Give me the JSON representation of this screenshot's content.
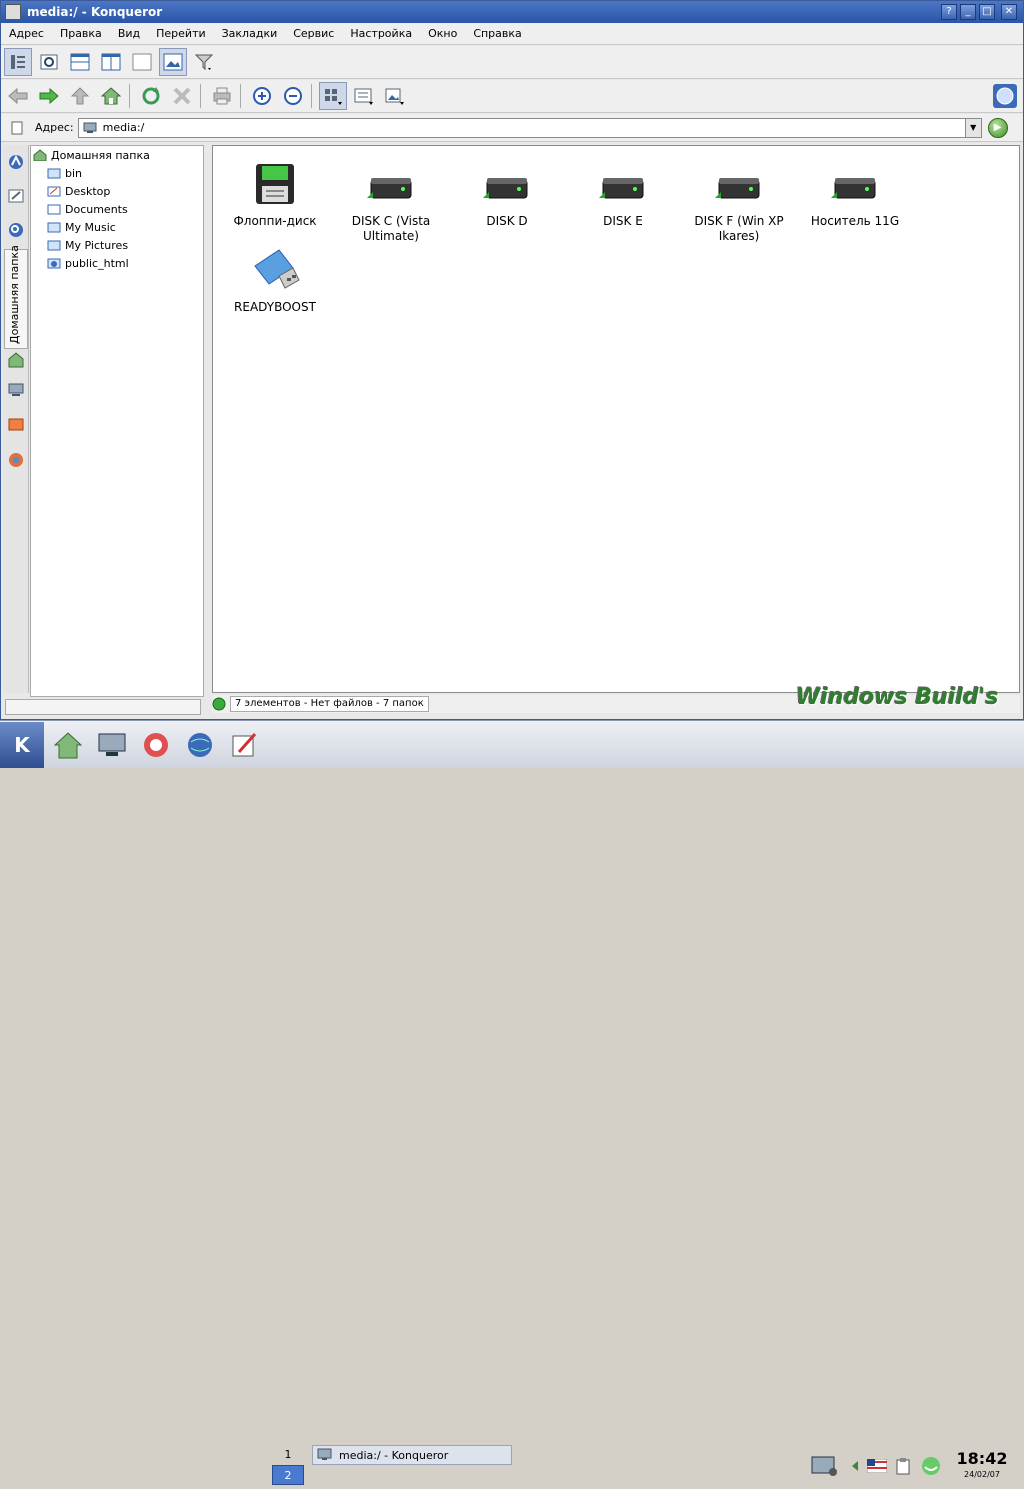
{
  "window": {
    "title": "media:/ - Konqueror"
  },
  "titlebar_buttons": [
    "?",
    "_",
    "□",
    "✕"
  ],
  "menu": [
    "Адрес",
    "Правка",
    "Вид",
    "Перейти",
    "Закладки",
    "Сервис",
    "Настройка",
    "Окно",
    "Справка"
  ],
  "address": {
    "label": "Адрес:",
    "value": "media:/"
  },
  "sidebar": {
    "tab_label": "Домашняя папка"
  },
  "tree": {
    "root": "Домашняя папка",
    "items": [
      "bin",
      "Desktop",
      "Documents",
      "My Music",
      "My Pictures",
      "public_html"
    ]
  },
  "icons": [
    {
      "label": "Флоппи-диск",
      "kind": "floppy-icon"
    },
    {
      "label": "DISK C (Vista Ultimate)",
      "kind": "hdd-icon"
    },
    {
      "label": "DISK D",
      "kind": "hdd-icon"
    },
    {
      "label": "DISK E",
      "kind": "hdd-icon"
    },
    {
      "label": "DISK F (Win XP Ikares)",
      "kind": "hdd-icon"
    },
    {
      "label": "Носитель 11G",
      "kind": "hdd-icon"
    },
    {
      "label": "READYBOOST",
      "kind": "usb-icon"
    }
  ],
  "status": {
    "text": "7 элементов - Нет файлов - 7 папок"
  },
  "watermark": "Windows Build's",
  "taskbar": {
    "pager": [
      "1",
      "2"
    ],
    "task": "media:/ - Konqueror",
    "clock": {
      "time": "18:42",
      "date": "24/02/07"
    }
  }
}
